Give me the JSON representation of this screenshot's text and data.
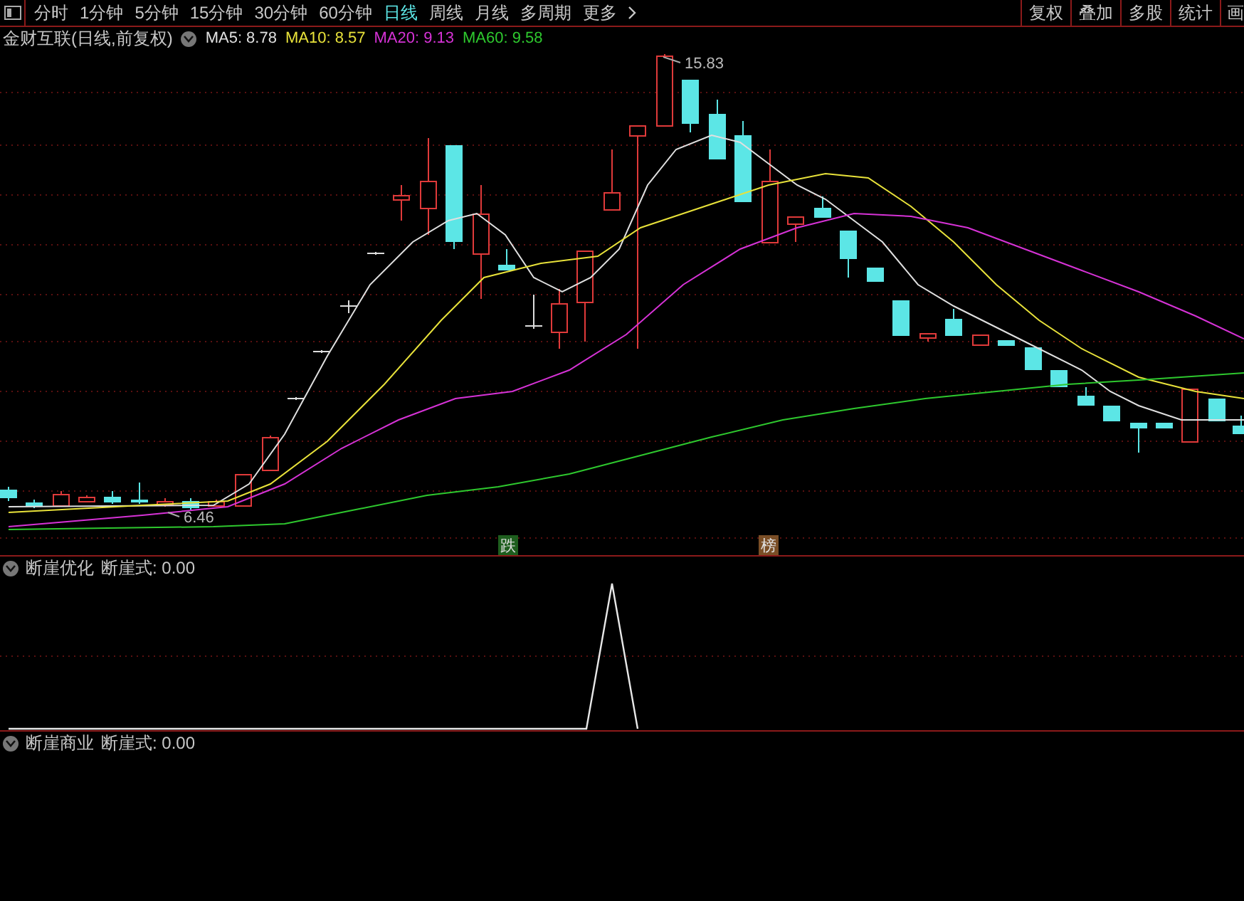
{
  "toolbar": {
    "periods": [
      {
        "label": "分时",
        "selected": false
      },
      {
        "label": "1分钟",
        "selected": false
      },
      {
        "label": "5分钟",
        "selected": false
      },
      {
        "label": "15分钟",
        "selected": false
      },
      {
        "label": "30分钟",
        "selected": false
      },
      {
        "label": "60分钟",
        "selected": false
      },
      {
        "label": "日线",
        "selected": true
      },
      {
        "label": "周线",
        "selected": false
      },
      {
        "label": "月线",
        "selected": false
      },
      {
        "label": "多周期",
        "selected": false
      },
      {
        "label": "更多",
        "selected": false
      }
    ],
    "buttons": [
      "复权",
      "叠加",
      "多股",
      "统计",
      "画"
    ]
  },
  "main_chart": {
    "title": "金财互联(日线,前复权)",
    "moving_averages": [
      {
        "label": "MA5: 8.78",
        "color": "#e0e0e0"
      },
      {
        "label": "MA10: 8.57",
        "color": "#e8e23a"
      },
      {
        "label": "MA20: 9.13",
        "color": "#d632d6"
      },
      {
        "label": "MA60: 9.58",
        "color": "#2ec82e"
      }
    ],
    "high_label": "15.83",
    "low_label": "6.46",
    "signals": [
      {
        "label": "跌",
        "color": "#1e5e1e"
      },
      {
        "label": "榜",
        "color": "#7a4e26"
      }
    ]
  },
  "panels": [
    {
      "name": "断崖优化",
      "formula": "断崖式: 0.00"
    },
    {
      "name": "断崖商业",
      "formula": "断崖式: 0.00"
    }
  ]
}
